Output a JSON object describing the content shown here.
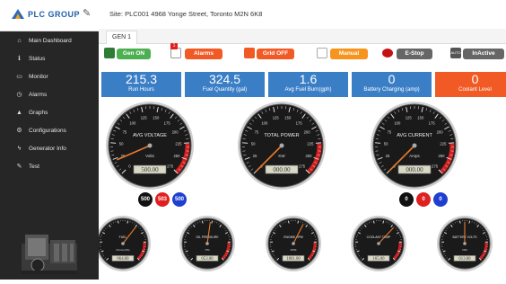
{
  "brand": {
    "name": "PLC GROUP"
  },
  "sidebar": {
    "items": [
      {
        "label": "Main Dashboard",
        "icon": "home-icon"
      },
      {
        "label": "Status",
        "icon": "info-icon"
      },
      {
        "label": "Monitor",
        "icon": "monitor-icon"
      },
      {
        "label": "Alarms",
        "icon": "alarm-clock-icon"
      },
      {
        "label": "Graphs",
        "icon": "image-icon"
      },
      {
        "label": "Configurations",
        "icon": "gear-icon"
      },
      {
        "label": "Generator Info",
        "icon": "lightning-icon"
      },
      {
        "label": "Test",
        "icon": "edit-icon"
      }
    ]
  },
  "header": {
    "site": "Site: PLC001  4968 Yonge Street, Toronto M2N 6K8"
  },
  "tabs": [
    {
      "label": "GEN 1",
      "active": true
    }
  ],
  "status": {
    "gen_on": "Gen ON",
    "alarms": "Alarms",
    "alarm_count": "1",
    "grid_off": "Grid OFF",
    "manual": "Manual",
    "estop": "E-Stop",
    "auto_icon_text": "AUTO",
    "inactive": "InActive"
  },
  "metrics": [
    {
      "value": "215.3",
      "label": "Run Hours",
      "color": "#3a7ec6"
    },
    {
      "value": "324.5",
      "label": "Fuel Quantity (gal)",
      "color": "#3a7ec6"
    },
    {
      "value": "1.6",
      "label": "Avg Fuel Burn(gph)",
      "color": "#3a7ec6"
    },
    {
      "value": "0",
      "label": "Battery Charging (amp)",
      "color": "#3a7ec6"
    },
    {
      "value": "0",
      "label": "Coolant Level",
      "color": "#f15a24"
    }
  ],
  "large_gauges": [
    {
      "title": "AVG VOLTAGE",
      "unit": "Volts",
      "readout": "500.00",
      "ticks": [
        "0",
        "25",
        "50",
        "75",
        "100",
        "125",
        "150",
        "175",
        "200",
        "225",
        "250",
        "275"
      ],
      "value_fraction": 0.08
    },
    {
      "title": "TOTAL POWER",
      "unit": "KW",
      "readout": "000.00",
      "ticks": [
        "0",
        "25",
        "50",
        "75",
        "100",
        "125",
        "150",
        "175",
        "200",
        "225",
        "250",
        "275"
      ],
      "value_fraction": 0.0
    },
    {
      "title": "AVG CURRENT",
      "unit": "Amps",
      "readout": "000.00",
      "ticks": [
        "0",
        "25",
        "50",
        "75",
        "100",
        "125",
        "150",
        "175",
        "200",
        "225",
        "250",
        "275"
      ],
      "value_fraction": 0.0
    }
  ],
  "phase_badges": [
    [
      "500",
      "503",
      "500"
    ],
    [
      "0",
      "0",
      "0"
    ]
  ],
  "small_gauges": [
    {
      "title": "FUEL",
      "unit": "Percent(%)",
      "readout": "064.00",
      "value_fraction": 0.64
    },
    {
      "title": "OIL PRESSURE",
      "unit": "PSI",
      "readout": "053.00",
      "value_fraction": 0.53
    },
    {
      "title": "ENGINE RPM",
      "unit": "RPM",
      "readout": "1801.00",
      "value_fraction": 0.6
    },
    {
      "title": "COOLANT TEMP",
      "unit": "",
      "readout": "165.00",
      "value_fraction": 0.66
    },
    {
      "title": "BATTERY VOLTS",
      "unit": "VDC",
      "readout": "013.80",
      "value_fraction": 0.5
    }
  ],
  "colors": {
    "sidebar_bg": "#262626",
    "gen_on": "#4caf50",
    "alarms": "#f15a24",
    "grid_off": "#f15a24",
    "manual": "#f7941d",
    "estop": "#666666",
    "inactive": "#666666",
    "metric_blue": "#3a7ec6",
    "metric_orange": "#f15a24",
    "badge_black": "#111111",
    "badge_red": "#e02020",
    "badge_blue": "#1f3fd1"
  }
}
